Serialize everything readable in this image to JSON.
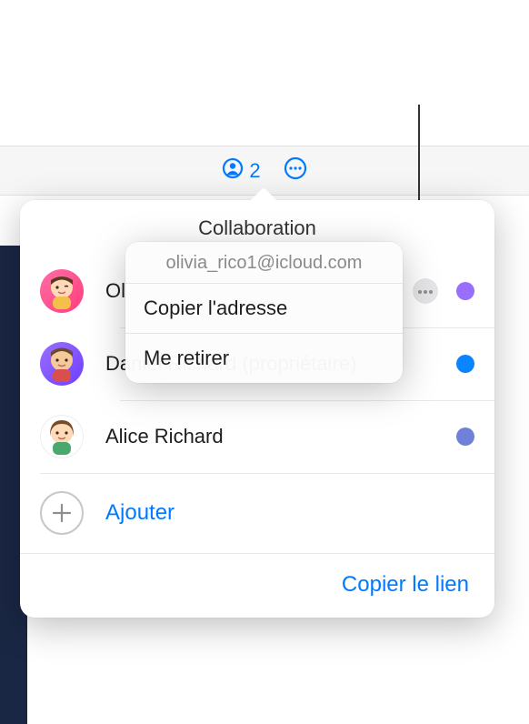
{
  "toolbar": {
    "collab_count": "2"
  },
  "popover": {
    "title": "Collaboration",
    "participants": [
      {
        "name": "Olivia Rico",
        "display": "Ol",
        "color": "#9a6fff",
        "has_more": true
      },
      {
        "name": "Daniel Richard (propriétaire)",
        "display": "Daniel Richard (propriétaire)",
        "color": "#0a84ff",
        "has_more": false
      },
      {
        "name": "Alice Richard",
        "display": "Alice Richard",
        "color": "#6f82d8",
        "has_more": false
      }
    ],
    "add_label": "Ajouter",
    "copy_link_label": "Copier le lien"
  },
  "context_menu": {
    "email": "olivia_rico1@icloud.com",
    "items": [
      "Copier l'adresse",
      "Me retirer"
    ]
  },
  "colors": {
    "accent": "#007aff"
  }
}
